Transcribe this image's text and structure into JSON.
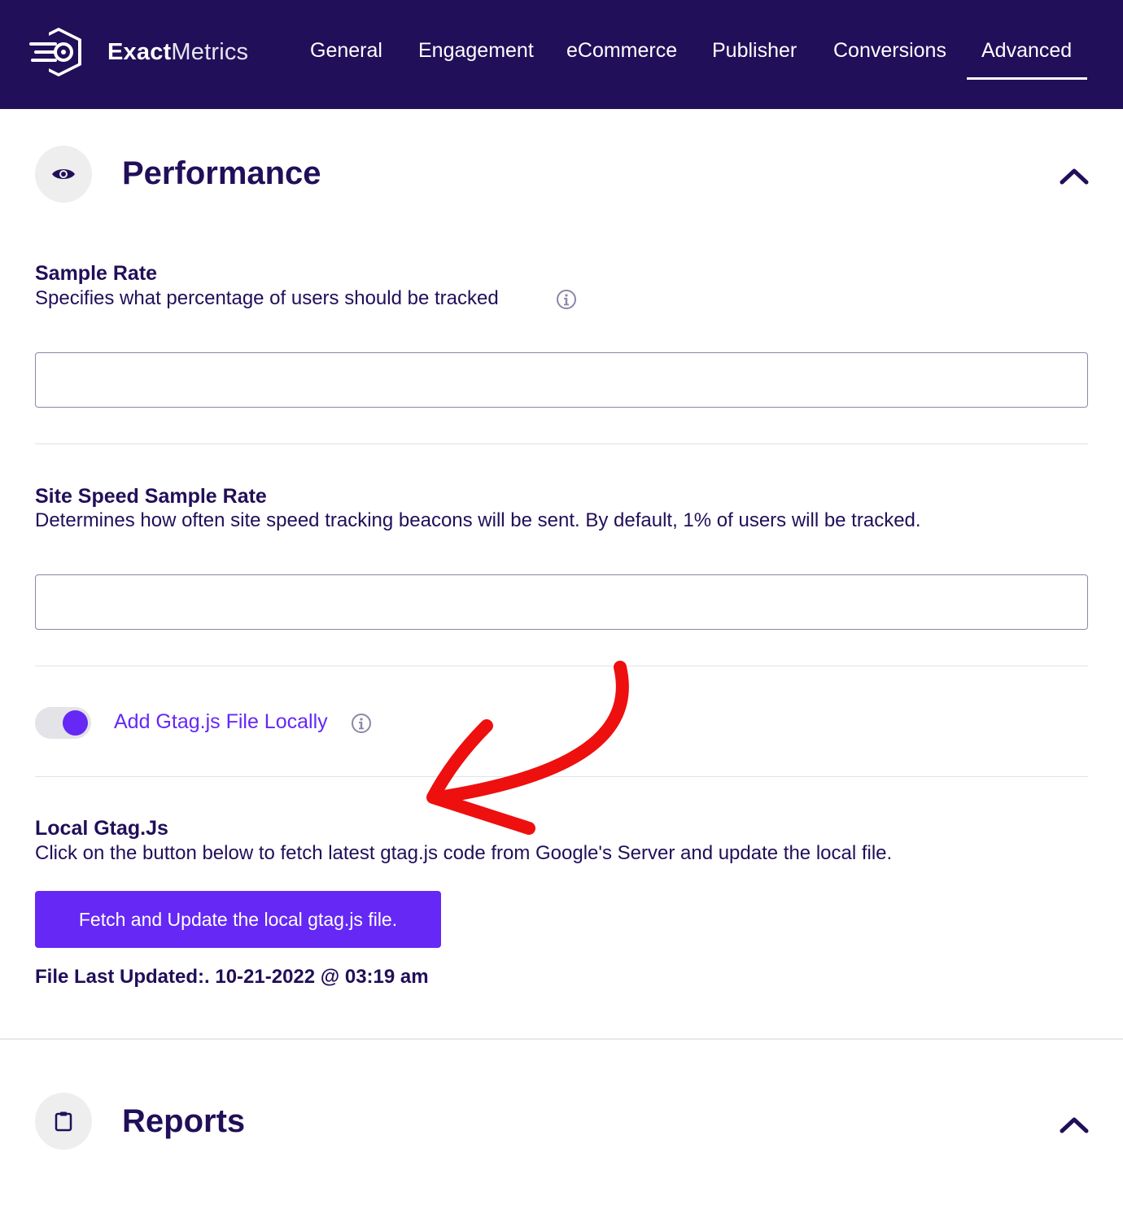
{
  "header": {
    "brand_bold": "Exact",
    "brand_light": "Metrics",
    "tabs": [
      {
        "label": "General"
      },
      {
        "label": "Engagement"
      },
      {
        "label": "eCommerce"
      },
      {
        "label": "Publisher"
      },
      {
        "label": "Conversions"
      },
      {
        "label": "Advanced",
        "active": true
      }
    ]
  },
  "performance": {
    "title": "Performance",
    "icon": "eye-icon",
    "sample_rate": {
      "title": "Sample Rate",
      "description": "Specifies what percentage of users should be tracked",
      "value": ""
    },
    "site_speed": {
      "title": "Site Speed Sample Rate",
      "description": "Determines how often site speed tracking beacons will be sent. By default, 1% of users will be tracked.",
      "value": ""
    },
    "gtag_toggle": {
      "label": "Add Gtag.js File Locally",
      "enabled": true
    },
    "local_gtag": {
      "title": "Local Gtag.Js",
      "description": "Click on the button below to fetch latest gtag.js code from Google's Server and update the local file.",
      "button_label": "Fetch and Update the local gtag.js file.",
      "last_updated": "File Last Updated:. 10-21-2022 @ 03:19 am"
    }
  },
  "reports": {
    "title": "Reports",
    "icon": "clipboard-icon"
  },
  "colors": {
    "navy": "#210f59",
    "accent": "#6528f5",
    "annotation": "#ee0f0f"
  }
}
